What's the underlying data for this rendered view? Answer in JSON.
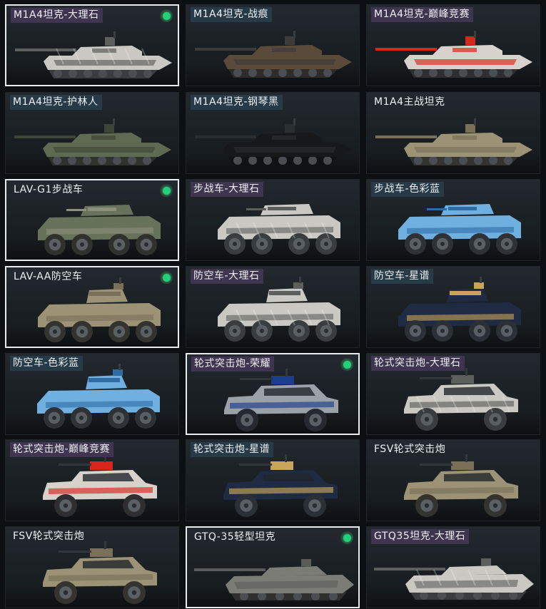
{
  "skins": [
    {
      "label": "M1A4坦克-大理石",
      "tier": "purple",
      "selected": true,
      "owned": true,
      "kind": "tank",
      "paint": "marble"
    },
    {
      "label": "M1A4坦克-战痕",
      "tier": "blue",
      "selected": false,
      "owned": false,
      "kind": "tank",
      "paint": "scar"
    },
    {
      "label": "M1A4坦克-巅峰竞赛",
      "tier": "purple",
      "selected": false,
      "owned": false,
      "kind": "tank",
      "paint": "racing"
    },
    {
      "label": "M1A4坦克-护林人",
      "tier": "blue",
      "selected": false,
      "owned": false,
      "kind": "tank",
      "paint": "forest"
    },
    {
      "label": "M1A4坦克-钢琴黑",
      "tier": "blue",
      "selected": false,
      "owned": false,
      "kind": "tank",
      "paint": "black"
    },
    {
      "label": "M1A4主战坦克",
      "tier": "none",
      "selected": false,
      "owned": false,
      "kind": "tank",
      "paint": "desert"
    },
    {
      "label": "LAV-G1步战车",
      "tier": "none",
      "selected": true,
      "owned": true,
      "kind": "ifv",
      "paint": "green"
    },
    {
      "label": "步战车-大理石",
      "tier": "purple",
      "selected": false,
      "owned": false,
      "kind": "ifv",
      "paint": "marble"
    },
    {
      "label": "步战车-色彩蓝",
      "tier": "blue",
      "selected": false,
      "owned": false,
      "kind": "ifv",
      "paint": "blue"
    },
    {
      "label": "LAV-AA防空车",
      "tier": "none",
      "selected": true,
      "owned": true,
      "kind": "aa",
      "paint": "desert"
    },
    {
      "label": "防空车-大理石",
      "tier": "purple",
      "selected": false,
      "owned": false,
      "kind": "aa",
      "paint": "marble"
    },
    {
      "label": "防空车-星谱",
      "tier": "blue",
      "selected": false,
      "owned": false,
      "kind": "aa",
      "paint": "navy"
    },
    {
      "label": "防空车-色彩蓝",
      "tier": "blue",
      "selected": false,
      "owned": false,
      "kind": "aa",
      "paint": "blue"
    },
    {
      "label": "轮式突击炮-荣耀",
      "tier": "purple",
      "selected": true,
      "owned": true,
      "kind": "assault",
      "paint": "glory"
    },
    {
      "label": "轮式突击炮-大理石",
      "tier": "purple",
      "selected": false,
      "owned": false,
      "kind": "assault",
      "paint": "marble"
    },
    {
      "label": "轮式突击炮-巅峰竞赛",
      "tier": "purple",
      "selected": false,
      "owned": false,
      "kind": "assault",
      "paint": "racing"
    },
    {
      "label": "轮式突击炮-星谱",
      "tier": "blue",
      "selected": false,
      "owned": false,
      "kind": "assault",
      "paint": "navy"
    },
    {
      "label": "FSV轮式突击炮",
      "tier": "none",
      "selected": false,
      "owned": false,
      "kind": "assault",
      "paint": "desert"
    },
    {
      "label": "FSV轮式突击炮",
      "tier": "none",
      "selected": false,
      "owned": false,
      "kind": "assault",
      "paint": "desert"
    },
    {
      "label": "GTQ-35轻型坦克",
      "tier": "none",
      "selected": true,
      "owned": true,
      "kind": "light",
      "paint": "grey"
    },
    {
      "label": "GTQ35坦克-大理石",
      "tier": "purple",
      "selected": false,
      "owned": false,
      "kind": "light",
      "paint": "marble"
    }
  ],
  "paints": {
    "marble": {
      "body": "#c9c8c2",
      "accent": "#5d5f5c",
      "wheel": "#3a3d3f"
    },
    "scar": {
      "body": "#5a4a3a",
      "accent": "#3d3a3a",
      "wheel": "#2e2c2a"
    },
    "racing": {
      "body": "#d7d2cc",
      "accent": "#d8261d",
      "wheel": "#2f2f31"
    },
    "forest": {
      "body": "#5e6a52",
      "accent": "#3d4636",
      "wheel": "#2f332c"
    },
    "black": {
      "body": "#161819",
      "accent": "#2b2e31",
      "wheel": "#101213"
    },
    "desert": {
      "body": "#9c9275",
      "accent": "#7a705a",
      "wheel": "#34332f"
    },
    "green": {
      "body": "#66725a",
      "accent": "#8d907f",
      "wheel": "#2f312d"
    },
    "blue": {
      "body": "#6fb0e0",
      "accent": "#2f6ca3",
      "wheel": "#2e3236"
    },
    "navy": {
      "body": "#1f2b42",
      "accent": "#c9a45a",
      "wheel": "#2b2f36"
    },
    "glory": {
      "body": "#9aa1a7",
      "accent": "#1b3e8c",
      "wheel": "#262a30"
    },
    "grey": {
      "body": "#7b7c76",
      "accent": "#5b5c58",
      "wheel": "#2f302e"
    }
  }
}
